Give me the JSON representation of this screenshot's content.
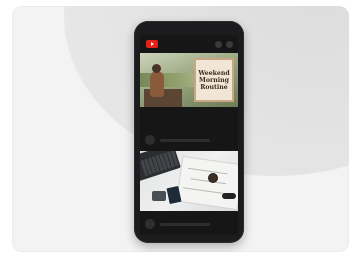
{
  "app": {
    "logo_icon": "youtube-logo-icon",
    "accent_color": "#e62117"
  },
  "videos": [
    {
      "thumbnail_title_lines": [
        "Weekend",
        "Morning",
        "Routine"
      ]
    },
    {
      "thumbnail_title_lines": []
    }
  ]
}
